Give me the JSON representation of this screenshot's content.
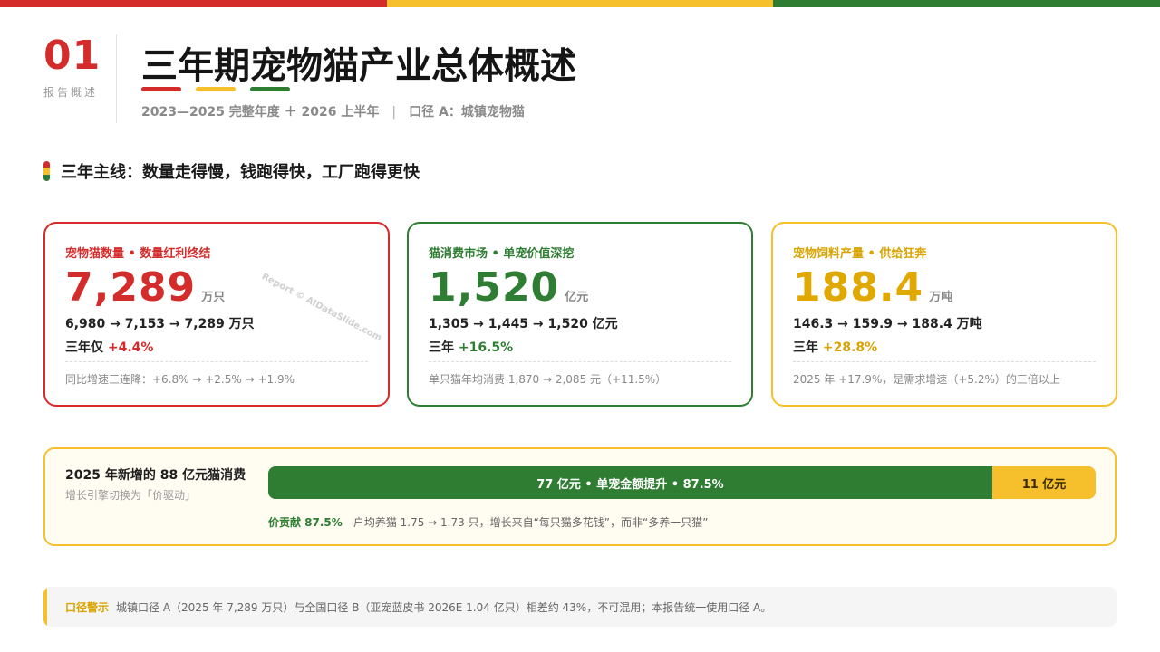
{
  "colors": {
    "red": "#d42b2b",
    "yellow": "#f6c02d",
    "green": "#2e7d32",
    "gold": "#d9a300"
  },
  "header": {
    "number": "01",
    "number_sub": "报告概述",
    "title": "三年期宠物猫产业总体概述",
    "subtitle_period": "2023—2025 完整年度 ＋ 2026 上半年",
    "subtitle_sep": "|",
    "subtitle_scope": "口径 A：城镇宠物猫"
  },
  "main_line": "三年主线：数量走得慢，钱跑得快，工厂跑得更快",
  "watermark": "Report © AIDataSlide.com",
  "cards": [
    {
      "title": "宠物猫数量 • 数量红利终结",
      "big_value": "7,289",
      "unit": "万只",
      "trend": "6,980 → 7,153 → 7,289 万只",
      "growth_label": "三年仅",
      "growth_value": "+4.4%",
      "note": "同比增速三连降：+6.8% → +2.5% → +1.9%"
    },
    {
      "title": "猫消费市场 • 单宠价值深挖",
      "big_value": "1,520",
      "unit": "亿元",
      "trend": "1,305 → 1,445 → 1,520 亿元",
      "growth_label": "三年",
      "growth_value": "+16.5%",
      "note": "单只猫年均消费 1,870 → 2,085 元（+11.5%）"
    },
    {
      "title": "宠物饲料产量 • 供给狂奔",
      "big_value": "188.4",
      "unit": "万吨",
      "trend": "146.3 → 159.9 → 188.4 万吨",
      "growth_label": "三年",
      "growth_value": "+28.8%",
      "note": "2025 年 +17.9%，是需求增速（+5.2%）的三倍以上"
    }
  ],
  "contribution": {
    "title": "2025 年新增的 88 亿元猫消费",
    "subtitle": "增长引擎切换为「价驱动」",
    "total": 88,
    "segments": [
      {
        "value": 77,
        "label": "77 亿元 • 单宠金额提升 • 87.5%"
      },
      {
        "value": 11,
        "label": "11 亿元"
      }
    ],
    "note_highlight": "价贡献 87.5%",
    "note": "户均养猫 1.75 → 1.73 只，增长来自“每只猫多花钱”，而非“多养一只猫”"
  },
  "warning": {
    "label": "口径警示",
    "text": "城镇口径 A（2025 年 7,289 万只）与全国口径 B（亚宠蓝皮书 2026E 1.04 亿只）相差约 43%，不可混用；本报告统一使用口径 A。"
  }
}
